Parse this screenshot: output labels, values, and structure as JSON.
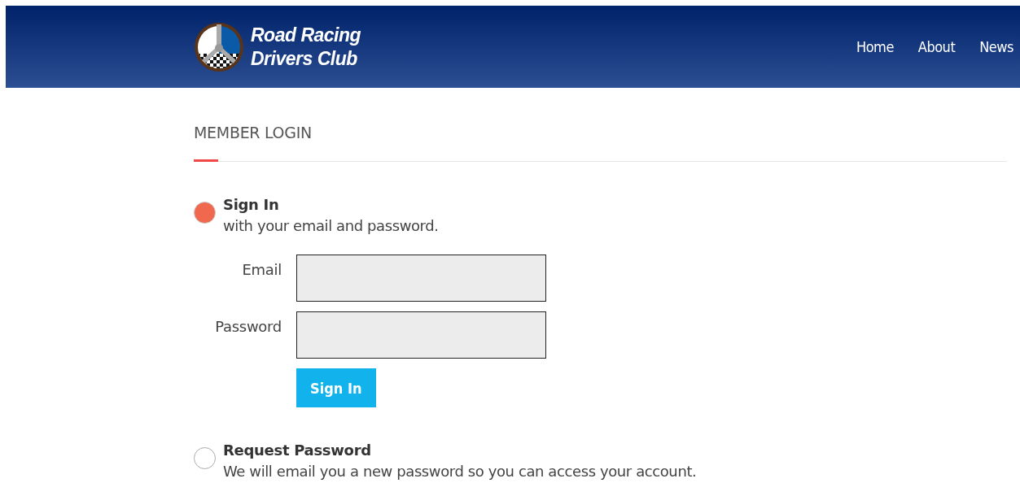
{
  "header": {
    "logo_title": "Road Racing",
    "logo_subtitle": "Drivers Club",
    "nav": [
      {
        "label": "Home"
      },
      {
        "label": "About"
      },
      {
        "label": "News"
      }
    ]
  },
  "section_title": "MEMBER LOGIN",
  "options": [
    {
      "title": "Sign In",
      "description": "with your email and password.",
      "selected": true,
      "fields": [
        {
          "label": "Email"
        },
        {
          "label": "Password"
        }
      ],
      "button": "Sign In"
    },
    {
      "title": "Request Password",
      "description": "We will email you a new password so you can access your account.",
      "selected": false
    }
  ]
}
